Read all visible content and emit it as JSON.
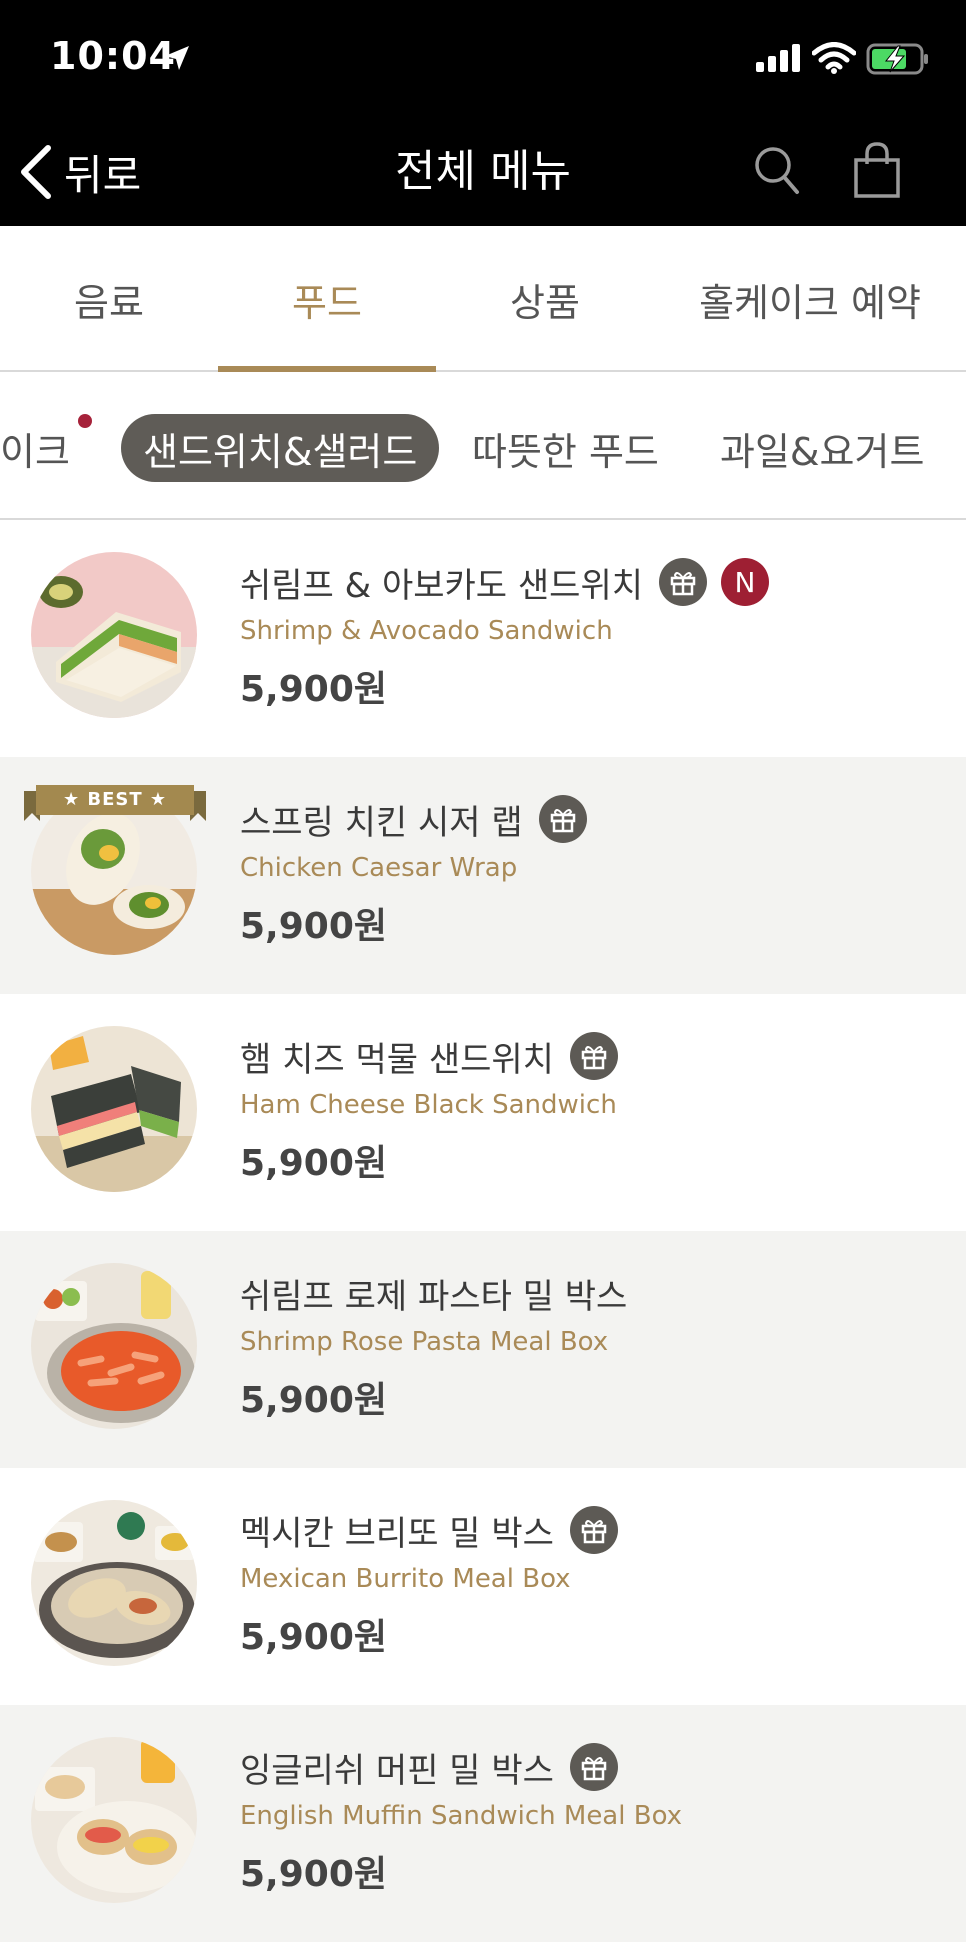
{
  "status_bar": {
    "time": "10:04"
  },
  "nav": {
    "back_label": "뒤로",
    "title": "전체 메뉴"
  },
  "tabs": [
    {
      "label": "음료",
      "active": false
    },
    {
      "label": "푸드",
      "active": true
    },
    {
      "label": "상품",
      "active": false
    },
    {
      "label": "홀케이크 예약",
      "active": false
    }
  ],
  "subcategories": [
    {
      "label": "이크",
      "active": false,
      "has_dot": true
    },
    {
      "label": "샌드위치&샐러드",
      "active": true
    },
    {
      "label": "따뜻한 푸드",
      "active": false
    },
    {
      "label": "과일&요거트",
      "active": false
    }
  ],
  "best_badge": "★ BEST ★",
  "new_badge": "N",
  "colors": {
    "accent": "#a98a57",
    "dark_chip": "#5f5c57",
    "new_badge": "#9e1f33"
  },
  "items": [
    {
      "name": "쉬림프 & 아보카도 샌드위치",
      "english": "Shrimp & Avocado Sandwich",
      "price": "5,900원",
      "gift": true,
      "new": true,
      "best": false
    },
    {
      "name": "스프링 치킨 시저 랩",
      "english": "Chicken Caesar Wrap",
      "price": "5,900원",
      "gift": true,
      "new": false,
      "best": true
    },
    {
      "name": "햄 치즈 먹물 샌드위치",
      "english": "Ham Cheese Black Sandwich",
      "price": "5,900원",
      "gift": true,
      "new": false,
      "best": false
    },
    {
      "name": "쉬림프 로제 파스타 밀 박스",
      "english": "Shrimp Rose Pasta Meal Box",
      "price": "5,900원",
      "gift": false,
      "new": false,
      "best": false
    },
    {
      "name": "멕시칸 브리또 밀 박스",
      "english": "Mexican Burrito Meal Box",
      "price": "5,900원",
      "gift": true,
      "new": false,
      "best": false
    },
    {
      "name": "잉글리쉬 머핀 밀 박스",
      "english": "English Muffin Sandwich Meal Box",
      "price": "5,900원",
      "gift": true,
      "new": false,
      "best": false
    }
  ]
}
